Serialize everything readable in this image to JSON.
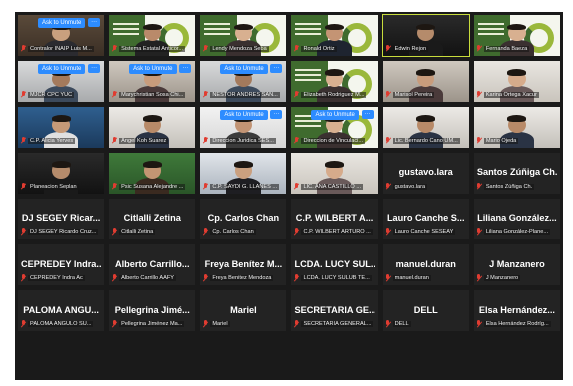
{
  "meeting": {
    "unmute_label": "Ask to Unmute",
    "more_label": "···"
  },
  "tiles": [
    {
      "name": "Contralor INAIP Luis M...",
      "video": true,
      "scene": "bookshelf",
      "unmute": true
    },
    {
      "name": "Sistema Estatal Anticor...",
      "video": true,
      "scene": "logo"
    },
    {
      "name": "Lendy Mendoza Seba",
      "video": true,
      "scene": "logo-woman"
    },
    {
      "name": "Ronald Ortiz",
      "video": true,
      "scene": "logo-man"
    },
    {
      "name": "Edwin Rejon",
      "video": true,
      "scene": "dark-man",
      "active": true
    },
    {
      "name": "Fernanda Baeza",
      "video": true,
      "scene": "logo-woman"
    },
    {
      "name": "MJCR CPC YUC",
      "video": true,
      "scene": "office",
      "unmute": true
    },
    {
      "name": "Marychristian Sosa Chi...",
      "video": true,
      "scene": "woman",
      "unmute": true
    },
    {
      "name": "NESTOR ANDRES SAN...",
      "video": true,
      "scene": "office",
      "unmute": true
    },
    {
      "name": "Elizabeth Rodriguez M...",
      "video": true,
      "scene": "logo-woman"
    },
    {
      "name": "Marisol Pereira",
      "video": true,
      "scene": "woman"
    },
    {
      "name": "Karina Ortega Xacur",
      "video": true,
      "scene": "woman-light"
    },
    {
      "name": "C.P. Alicia Yerves",
      "video": true,
      "scene": "blue"
    },
    {
      "name": "Angel Koh Suarez",
      "video": true,
      "scene": "man-light"
    },
    {
      "name": "Direccion Juridica SES...",
      "video": true,
      "scene": "logo-text",
      "unmute": true
    },
    {
      "name": "Direccion de Vinculaci...",
      "video": true,
      "scene": "logo-woman",
      "unmute": true
    },
    {
      "name": "Lic. Bernardo Cano UM...",
      "video": true,
      "scene": "man-light"
    },
    {
      "name": "Mario Ojeda",
      "video": true,
      "scene": "man-light"
    },
    {
      "name": "Planeacion Seplan",
      "video": true,
      "scene": "dark-man"
    },
    {
      "name": "Psic Susana Alejandre ...",
      "video": true,
      "scene": "green"
    },
    {
      "name": "C.P. SAYDI G. LLANES ...",
      "video": true,
      "scene": "woman-dark"
    },
    {
      "name": "LIC. ANA CASTILLO ...",
      "video": true,
      "scene": "woman-light"
    },
    {
      "name": "gustavo.lara",
      "big": "gustavo.lara",
      "video": false
    },
    {
      "name": "Santos Zúñiga Ch.",
      "big": "Santos Zúñiga Ch.",
      "video": false
    },
    {
      "name": "DJ SEGEY Ricardo Cruz...",
      "big": "DJ SEGEY Ricar...",
      "video": false
    },
    {
      "name": "Citlalli Zetina",
      "big": "Citlalli Zetina",
      "video": false
    },
    {
      "name": "Cp. Carlos Chan",
      "big": "Cp. Carlos Chan",
      "video": false
    },
    {
      "name": "C.P. WILBERT ARTURO ...",
      "big": "C.P. WILBERT A...",
      "video": false
    },
    {
      "name": "Lauro Canche SESEAY",
      "big": "Lauro Canche S...",
      "video": false
    },
    {
      "name": "Liliana González-Plane...",
      "big": "Liliana González...",
      "video": false
    },
    {
      "name": "CEPREDEY Indra Ac",
      "big": "CEPREDEY Indra...",
      "video": false
    },
    {
      "name": "Alberto Carrillo AAFY",
      "big": "Alberto Carrillo...",
      "video": false
    },
    {
      "name": "Freya Benitez Mendoza",
      "big": "Freya Benítez M...",
      "video": false
    },
    {
      "name": "LCDA. LUCY SULUB TE...",
      "big": "LCDA. LUCY SUL...",
      "video": false
    },
    {
      "name": "manuel.duran",
      "big": "manuel.duran",
      "video": false
    },
    {
      "name": "J Manzanero",
      "big": "J Manzanero",
      "video": false
    },
    {
      "name": "PALOMA ANGULO SU...",
      "big": "PALOMA ANGU...",
      "video": false
    },
    {
      "name": "Pellegrina Jiménez Ma...",
      "big": "Pellegrina Jimé...",
      "video": false
    },
    {
      "name": "Mariel",
      "big": "Mariel",
      "video": false
    },
    {
      "name": "SECRETARIA GENERAL...",
      "big": "SECRETARIA GE...",
      "video": false
    },
    {
      "name": "DELL",
      "big": "DELL",
      "video": false
    },
    {
      "name": "Elsa Hernández Rodríg...",
      "big": "Elsa Hernández...",
      "video": false
    }
  ],
  "colors": {
    "grid_bg": "#1a1a1a",
    "tile_bg": "#232323",
    "unmute_blue": "#2d8cff",
    "muted_red": "#e03c31",
    "active_border": "#c8dc3c"
  }
}
